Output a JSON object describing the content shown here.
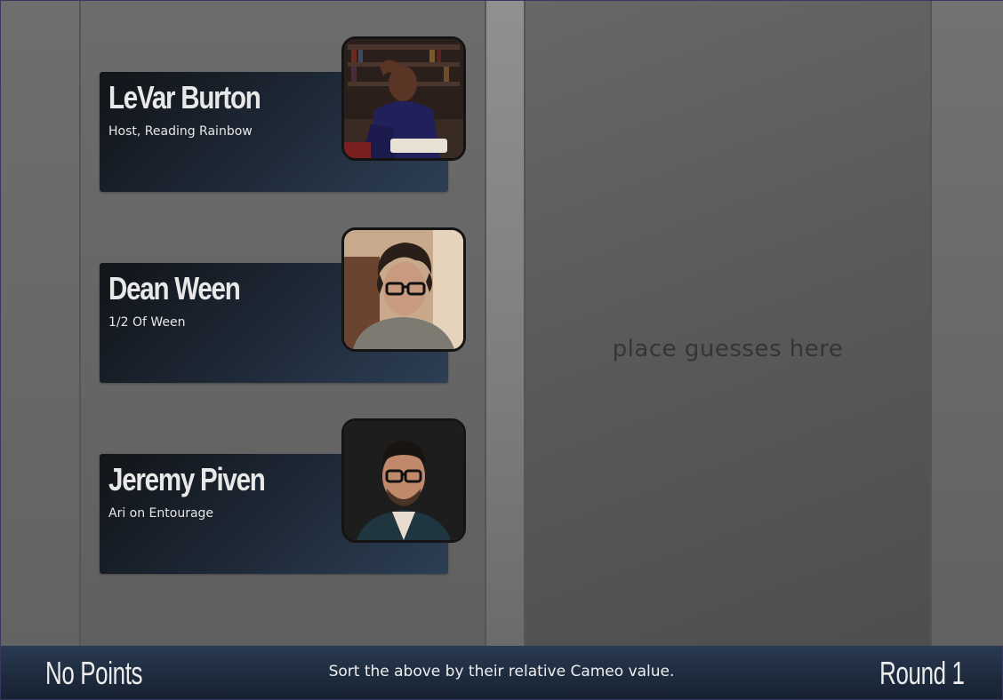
{
  "board": {
    "drop_zone_placeholder": "place guesses here"
  },
  "cards": [
    {
      "name": "LeVar Burton",
      "description": "Host, Reading Rainbow"
    },
    {
      "name": "Dean Ween",
      "description": "1/2 Of Ween"
    },
    {
      "name": "Jeremy Piven",
      "description": "Ari on Entourage"
    }
  ],
  "footer": {
    "score": "No Points",
    "instructions": "Sort the above by their relative Cameo value.",
    "round": "Round 1"
  },
  "colors": {
    "card_gradient_start": "#121418",
    "card_gradient_end": "#2d3f55",
    "footer_background": "#1f2d40",
    "text_light": "#e8e8e8"
  }
}
